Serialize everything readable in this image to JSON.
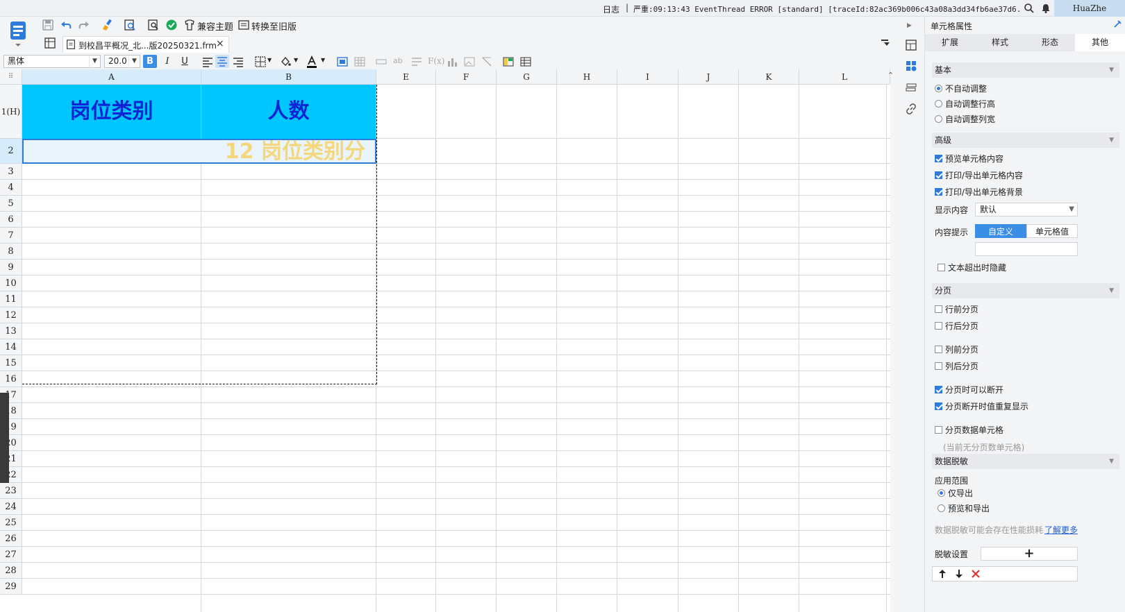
{
  "topbar": {
    "log_label": "日志",
    "separator": "|",
    "error_text": "严重:09:13:43 EventThread ERROR [standard] [traceId:82ac369b006c43a08a3dd34fb6ae37d6.18611...",
    "user": "HuaZhe"
  },
  "toolbar": {
    "compat_theme_label": "兼容主题",
    "convert_old_label": "转换至旧版"
  },
  "file_tab": {
    "name": "到校昌平概况_北...版20250321.frm",
    "close": "×"
  },
  "format": {
    "font_family": "黑体",
    "font_size": "20.0",
    "bold": "B",
    "italic": "I",
    "underline": "U"
  },
  "sheet": {
    "columns": [
      "A",
      "B",
      "E",
      "F",
      "G",
      "H",
      "I",
      "J",
      "K",
      "L"
    ],
    "rows": [
      "1(H)",
      "2",
      "3",
      "4",
      "5",
      "6",
      "7",
      "8",
      "9",
      "10",
      "11",
      "12",
      "13",
      "14",
      "15",
      "16",
      "17",
      "18",
      "19",
      "20",
      "21",
      "22",
      "23",
      "24",
      "25",
      "26",
      "27",
      "28",
      "29"
    ],
    "header_cells": [
      "岗位类别",
      "人数"
    ],
    "row2_text": "12  岗位类别分",
    "header_fill": "#00c6ff",
    "header_text_color": "#0d24d6"
  },
  "panel": {
    "title": "单元格属性",
    "tabs": [
      "扩展",
      "样式",
      "形态",
      "其他"
    ],
    "active_tab": "其他",
    "basic": {
      "title": "基本",
      "options": [
        "不自动调整",
        "自动调整行高",
        "自动调整列宽"
      ],
      "selected": "不自动调整"
    },
    "advanced": {
      "title": "高级",
      "checks": [
        {
          "label": "预览单元格内容",
          "checked": true
        },
        {
          "label": "打印/导出单元格内容",
          "checked": true
        },
        {
          "label": "打印/导出单元格背景",
          "checked": true
        }
      ],
      "display_label": "显示内容",
      "display_value": "默认",
      "tip_label": "内容提示",
      "tip_options": [
        "自定义",
        "单元格值"
      ],
      "tip_active": "自定义",
      "hide_overflow": "文本超出时隐藏"
    },
    "paging": {
      "title": "分页",
      "row_before": "行前分页",
      "row_after": "行后分页",
      "col_before": "列前分页",
      "col_after": "列后分页",
      "breakable": "分页时可以断开",
      "repeat": "分页断开时值重复显示",
      "data_cell": "分页数据单元格",
      "no_data_cell": "(当前无分页数单元格)"
    },
    "desensitize": {
      "title": "数据脱敏",
      "scope_label": "应用范围",
      "scope_options": [
        "仅导出",
        "预览和导出"
      ],
      "scope_selected": "仅导出",
      "perf_hint": "数据脱敏可能会存在性能损耗",
      "learn_more": "了解更多",
      "settings_label": "脱敏设置",
      "add": "+"
    }
  },
  "colors": {
    "accent": "#3a8ee6",
    "selection_border": "#2f7bdc"
  }
}
